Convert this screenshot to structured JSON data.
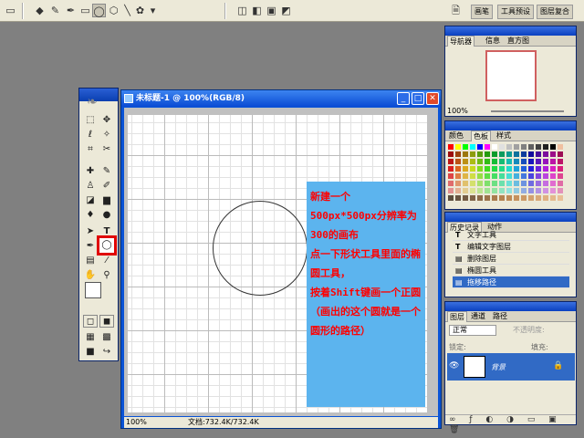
{
  "optbar": {
    "palette_tabs": [
      "画笔",
      "工具预设",
      "图层复合"
    ]
  },
  "toolbox": {
    "highlight_color": "#e00000"
  },
  "document": {
    "title": "未标题-1 @ 100%(RGB/8)",
    "zoom": "100%",
    "doc_info": "文档:732.4K/732.4K"
  },
  "note": {
    "text": "新建一个\n500px*500px分辨率为300的画布\n点一下形状工具里面的椭圆工具，\n按着Shift键画一个正圆（画出的这个圆就是一个圆形的路径）"
  },
  "navigator": {
    "tabs": [
      "导航器",
      "信息",
      "直方图"
    ],
    "zoom": "100%"
  },
  "color_panel": {
    "tabs": [
      "颜色",
      "色板",
      "样式"
    ]
  },
  "history": {
    "tabs": [
      "历史记录",
      "动作"
    ],
    "items": [
      "文字工具",
      "编辑文字图层",
      "删除图层",
      "椭圆工具",
      "拖移路径"
    ]
  },
  "layers": {
    "tabs": [
      "图层",
      "通道",
      "路径"
    ],
    "blend_mode": "正常",
    "opacity_label": "不透明度:",
    "lock_label": "锁定:",
    "fill_label": "填充:",
    "layer_name": "背景"
  }
}
